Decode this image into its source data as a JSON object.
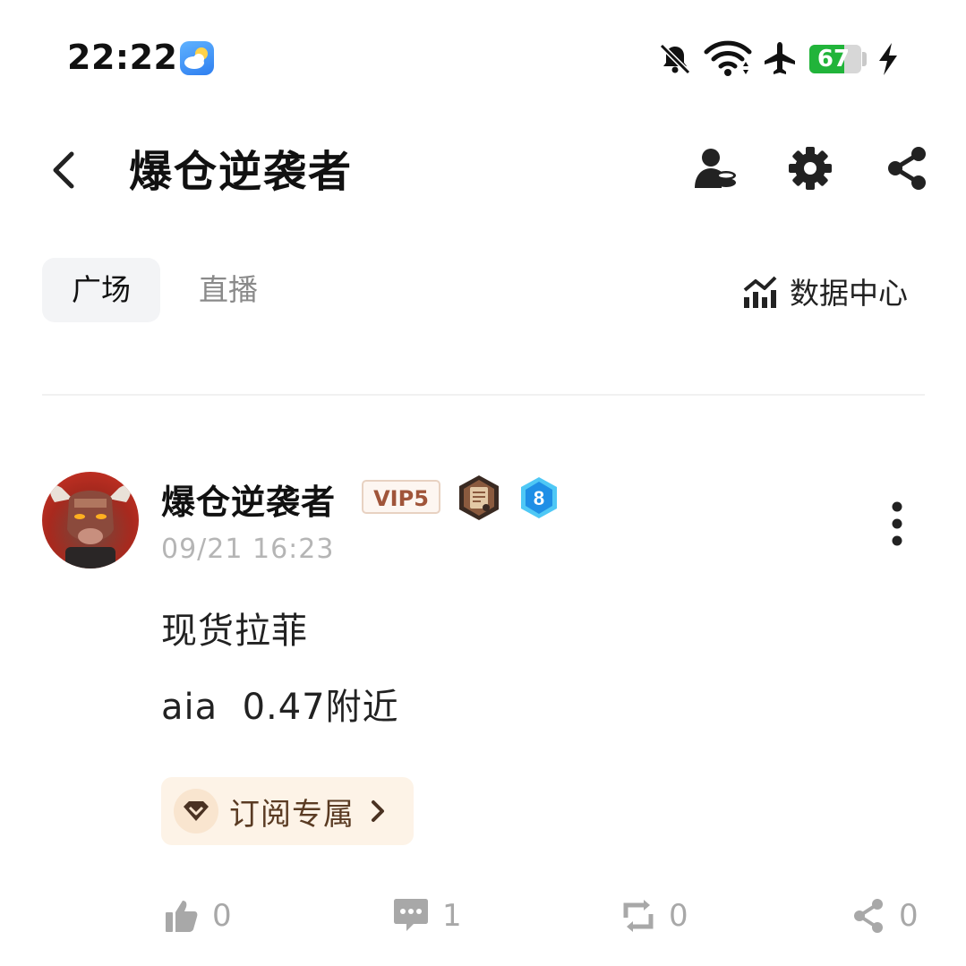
{
  "status_bar": {
    "time": "22:22",
    "battery": "67",
    "battery_level": 0.67
  },
  "header": {
    "title": "爆仓逆袭者",
    "icons": [
      "back-icon",
      "user-coin-icon",
      "gear-icon",
      "share-icon"
    ]
  },
  "tabs": {
    "active": "广场",
    "items": [
      "广场",
      "直播"
    ],
    "data_center": "数据中心"
  },
  "post": {
    "username": "爆仓逆袭者",
    "vip": "VIP5",
    "level": "8",
    "time": "09/21 16:23",
    "lines": [
      "现货拉菲",
      "aia  0.47附近"
    ],
    "subscribe_label": "订阅专属"
  },
  "actions": {
    "likes": "0",
    "comments": "1",
    "reposts": "0",
    "shares": "0"
  },
  "colors": {
    "accent_green": "#21b43a",
    "vip_text": "#a0553a",
    "subscribe_bg": "#fdf3e7"
  }
}
